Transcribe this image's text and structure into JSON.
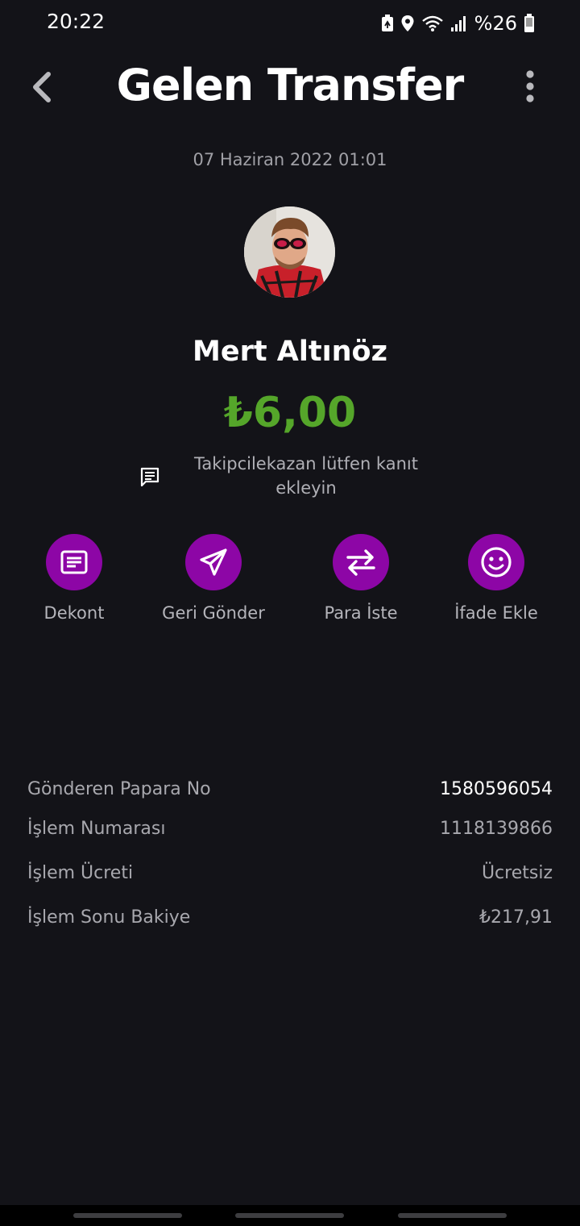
{
  "status_bar": {
    "time": "20:22",
    "battery": "%26",
    "icons": [
      "battery-saver-icon",
      "location-icon",
      "wifi-icon",
      "signal-icon",
      "battery-icon"
    ]
  },
  "header": {
    "title": "Gelen Transfer",
    "back_icon": "chevron-left-icon",
    "menu_icon": "more-vert-icon"
  },
  "transfer": {
    "date": "07 Haziran 2022 01:01",
    "sender_name": "Mert Altınöz",
    "amount": "₺6,00",
    "note": "Takipcilekazan lütfen kanıt ekleyin"
  },
  "actions": [
    {
      "label": "Dekont",
      "icon": "receipt-icon"
    },
    {
      "label": "Geri Gönder",
      "icon": "send-icon"
    },
    {
      "label": "Para İste",
      "icon": "swap-arrows-icon"
    },
    {
      "label": "İfade Ekle",
      "icon": "smiley-icon"
    }
  ],
  "details": [
    {
      "label": "Gönderen Papara No",
      "value": "1580596054"
    },
    {
      "label": "İşlem Numarası",
      "value": "1118139866"
    },
    {
      "label": "İşlem Ücreti",
      "value": "Ücretsiz"
    },
    {
      "label": "İşlem Sonu Bakiye",
      "value": "₺217,91"
    }
  ],
  "colors": {
    "background": "#131318",
    "accent": "#8d06a6",
    "amount": "#55a62a"
  }
}
